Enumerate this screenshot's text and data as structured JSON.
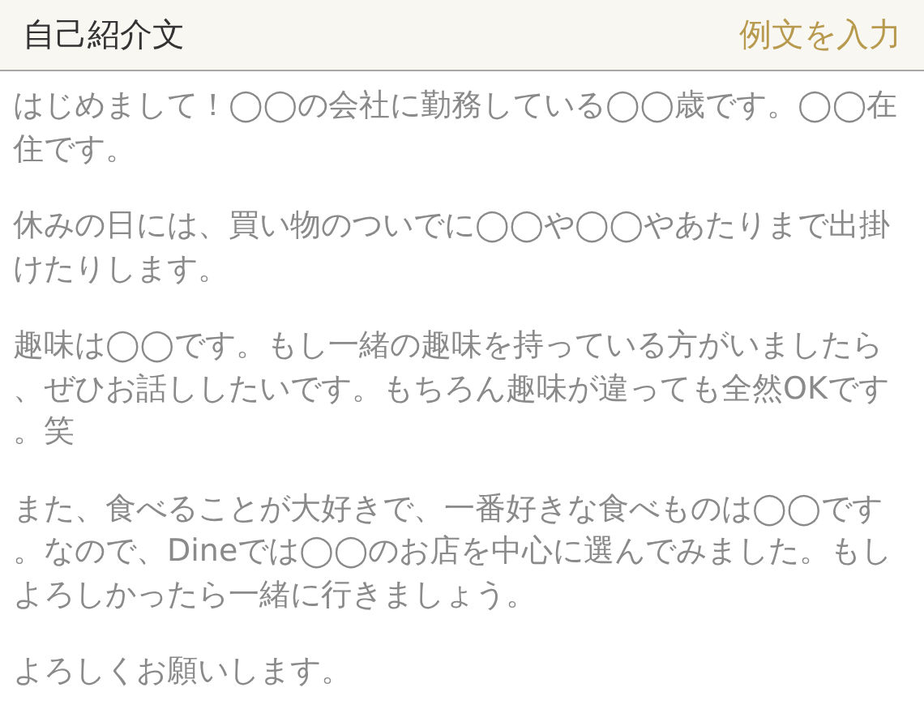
{
  "header": {
    "title": "自己紹介文",
    "action": "例文を入力"
  },
  "paragraphs": [
    "はじめまして！◯◯の会社に勤務している◯◯歳です。◯◯在住です。",
    "休みの日には、買い物のついでに◯◯や◯◯やあたりまで出掛けたりします。",
    "趣味は◯◯です。もし一緒の趣味を持っている方がいましたら、ぜひお話ししたいです。もちろん趣味が違っても全然OKです。笑",
    "また、食べることが大好きで、一番好きな食べものは◯◯です。なので、Dineでは◯◯のお店を中心に選んでみました。もしよろしかったら一緒に行きましょう。",
    "よろしくお願いします。"
  ]
}
